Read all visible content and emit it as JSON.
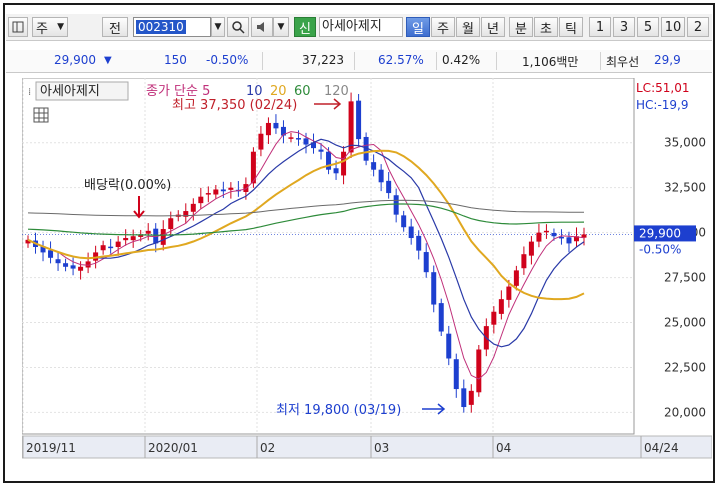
{
  "toolbar": {
    "type_label": "주",
    "prev_label": "전",
    "stock_code": "002310",
    "new_label": "신",
    "stock_name": "아세아제지",
    "periods": [
      "일",
      "주",
      "월",
      "년",
      "분",
      "초",
      "틱"
    ],
    "active_period": "일",
    "intervals": [
      "1",
      "3",
      "5",
      "10",
      "2"
    ]
  },
  "quote": {
    "price": "29,900",
    "direction": "▼",
    "change": "150",
    "change_pct": "-0.50%",
    "volume": "37,223",
    "ratio1": "62.57%",
    "ratio2": "0.42%",
    "amount": "1,106백만",
    "best_label": "최우선",
    "best_price": "29,9"
  },
  "chart": {
    "legend_name": "아세아제지",
    "legend_ma": "종가 단순 5",
    "legend_periods": [
      "10",
      "20",
      "60",
      "120"
    ],
    "lc": "LC:51,01",
    "hc": "HC:-19,9",
    "high_note": "최고 37,350 (02/24)",
    "low_note": "최저 19,800 (03/19)",
    "dividend_note": "배당락(0.00%)",
    "last_price": "29,900",
    "last_pct": "-0.50%",
    "x_labels": [
      "2019/11",
      "2020/01",
      "02",
      "03",
      "04",
      "04/24"
    ],
    "colors": {
      "up": "#d0021b",
      "down": "#1d3fcf",
      "ma5": "#c0307a",
      "ma10": "#2a3aa8",
      "ma20": "#e0a820",
      "ma60": "#2e8b3a",
      "ma120": "#6a6a6a"
    }
  },
  "chart_data": {
    "type": "candlestick",
    "y_ticks": [
      35000,
      32500,
      30000,
      27500,
      25000,
      22500,
      20000
    ],
    "ylim": [
      18800,
      38600
    ],
    "high": {
      "value": 37350,
      "date": "02/24"
    },
    "low": {
      "value": 19800,
      "date": "03/19"
    },
    "last_close": 29900,
    "closes": [
      29600,
      29200,
      28900,
      28600,
      28300,
      28100,
      28000,
      28100,
      28400,
      28900,
      29300,
      29200,
      29500,
      29700,
      29800,
      29900,
      30100,
      29400,
      30200,
      30800,
      31000,
      31200,
      31600,
      32000,
      32200,
      32400,
      32300,
      32500,
      32300,
      32700,
      34500,
      35500,
      36100,
      35800,
      35400,
      35300,
      35200,
      34900,
      34700,
      34500,
      33500,
      33300,
      34500,
      37300,
      35200,
      34000,
      33500,
      32800,
      32200,
      31000,
      30300,
      29700,
      29000,
      27800,
      26000,
      24500,
      23000,
      21300,
      20300,
      21200,
      23500,
      24800,
      25600,
      26300,
      27000,
      27900,
      28800,
      29500,
      30000,
      30100,
      29800,
      29700,
      29400,
      29800,
      29900
    ]
  }
}
